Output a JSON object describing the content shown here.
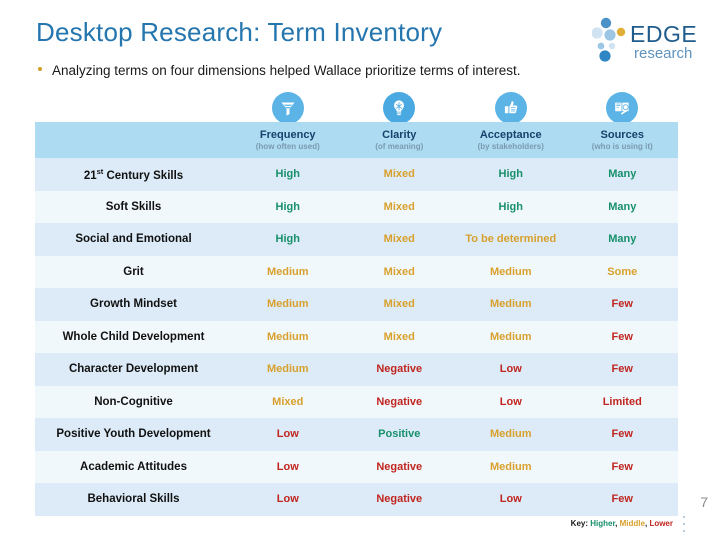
{
  "slide": {
    "title": "Desktop Research: Term Inventory",
    "bullet": "Analyzing terms on four dimensions helped Wallace prioritize terms of interest.",
    "page_number": "7",
    "title_color": "#2576ae",
    "bullet_marker_color": "#c9a227"
  },
  "logo": {
    "name": "EDGE research",
    "word_main": "EDGE",
    "word_sub": "research",
    "main_color": "#1f5c8b",
    "dot_colors": [
      "#4a92c8",
      "#9cc6e4",
      "#cfe3f3",
      "#e0ae36",
      "#2f86c5"
    ]
  },
  "columns": [
    {
      "key": "term",
      "label": "",
      "sublabel": "",
      "icon": ""
    },
    {
      "key": "frequency",
      "label": "Frequency",
      "sublabel": "(how often used)",
      "icon": "funnel-icon"
    },
    {
      "key": "clarity",
      "label": "Clarity",
      "sublabel": "(of meaning)",
      "icon": "lightbulb-icon"
    },
    {
      "key": "acceptance",
      "label": "Acceptance",
      "sublabel": "(by stakeholders)",
      "icon": "thumbs-up-icon"
    },
    {
      "key": "sources",
      "label": "Sources",
      "sublabel": "(who is using it)",
      "icon": "book-icon"
    }
  ],
  "rows": [
    {
      "term": "21st Century Skills",
      "term_sup": "st",
      "term_pre": "21",
      "term_post": " Century Skills",
      "frequency": {
        "text": "High",
        "level": "high"
      },
      "clarity": {
        "text": "Mixed",
        "level": "mid"
      },
      "acceptance": {
        "text": "High",
        "level": "high"
      },
      "sources": {
        "text": "Many",
        "level": "high"
      }
    },
    {
      "term": "Soft Skills",
      "frequency": {
        "text": "High",
        "level": "high"
      },
      "clarity": {
        "text": "Mixed",
        "level": "mid"
      },
      "acceptance": {
        "text": "High",
        "level": "high"
      },
      "sources": {
        "text": "Many",
        "level": "high"
      }
    },
    {
      "term": "Social and Emotional",
      "frequency": {
        "text": "High",
        "level": "high"
      },
      "clarity": {
        "text": "Mixed",
        "level": "mid"
      },
      "acceptance": {
        "text": "To be determined",
        "level": "tbd"
      },
      "sources": {
        "text": "Many",
        "level": "high"
      }
    },
    {
      "term": "Grit",
      "frequency": {
        "text": "Medium",
        "level": "mid"
      },
      "clarity": {
        "text": "Mixed",
        "level": "mid"
      },
      "acceptance": {
        "text": "Medium",
        "level": "mid"
      },
      "sources": {
        "text": "Some",
        "level": "mid"
      }
    },
    {
      "term": "Growth Mindset",
      "frequency": {
        "text": "Medium",
        "level": "mid"
      },
      "clarity": {
        "text": "Mixed",
        "level": "mid"
      },
      "acceptance": {
        "text": "Medium",
        "level": "mid"
      },
      "sources": {
        "text": "Few",
        "level": "low"
      }
    },
    {
      "term": "Whole Child Development",
      "frequency": {
        "text": "Medium",
        "level": "mid"
      },
      "clarity": {
        "text": "Mixed",
        "level": "mid"
      },
      "acceptance": {
        "text": "Medium",
        "level": "mid"
      },
      "sources": {
        "text": "Few",
        "level": "low"
      }
    },
    {
      "term": "Character Development",
      "frequency": {
        "text": "Medium",
        "level": "mid"
      },
      "clarity": {
        "text": "Negative",
        "level": "low"
      },
      "acceptance": {
        "text": "Low",
        "level": "low"
      },
      "sources": {
        "text": "Few",
        "level": "low"
      }
    },
    {
      "term": "Non-Cognitive",
      "frequency": {
        "text": "Mixed",
        "level": "mid"
      },
      "clarity": {
        "text": "Negative",
        "level": "low"
      },
      "acceptance": {
        "text": "Low",
        "level": "low"
      },
      "sources": {
        "text": "Limited",
        "level": "low"
      }
    },
    {
      "term": "Positive Youth Development",
      "frequency": {
        "text": "Low",
        "level": "low"
      },
      "clarity": {
        "text": "Positive",
        "level": "high"
      },
      "acceptance": {
        "text": "Medium",
        "level": "mid"
      },
      "sources": {
        "text": "Few",
        "level": "low"
      }
    },
    {
      "term": "Academic Attitudes",
      "frequency": {
        "text": "Low",
        "level": "low"
      },
      "clarity": {
        "text": "Negative",
        "level": "low"
      },
      "acceptance": {
        "text": "Medium",
        "level": "mid"
      },
      "sources": {
        "text": "Few",
        "level": "low"
      }
    },
    {
      "term": "Behavioral Skills",
      "frequency": {
        "text": "Low",
        "level": "low"
      },
      "clarity": {
        "text": "Negative",
        "level": "low"
      },
      "acceptance": {
        "text": "Low",
        "level": "low"
      },
      "sources": {
        "text": "Few",
        "level": "low"
      }
    }
  ],
  "key": {
    "label": "Key:",
    "higher": "Higher",
    "middle": "Middle",
    "lower": "Lower",
    "sep": ",",
    "higher_color": "#18906b",
    "middle_color": "#d8a02c",
    "lower_color": "#c0251f"
  }
}
